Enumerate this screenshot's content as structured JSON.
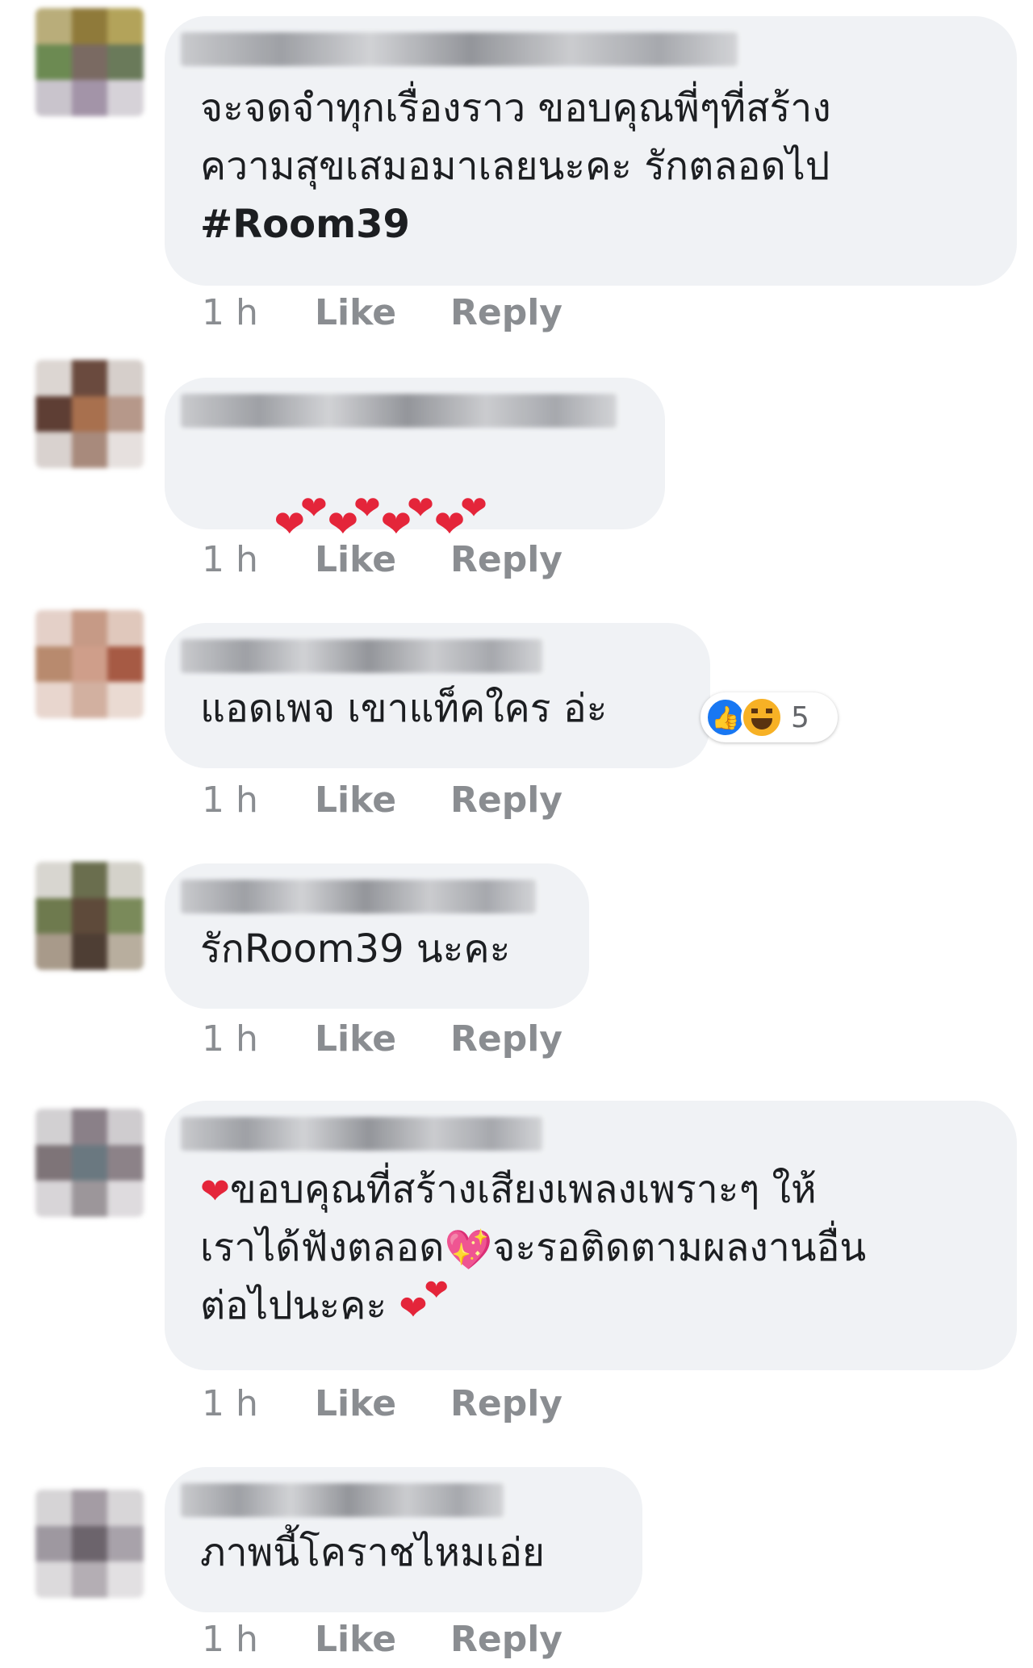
{
  "comments": [
    {
      "text": "จะจดจำทุกเรื่องราว ขอบคุณพี่ๆที่สร้าง\nความสุขเสมอมาเลยนะคะ รักตลอดไป",
      "hashtag": "#Room39",
      "time": "1 h",
      "like": "Like",
      "reply": "Reply"
    },
    {
      "text": "",
      "hearts": "❤❤❤❤",
      "time": "1 h",
      "like": "Like",
      "reply": "Reply"
    },
    {
      "text": "แอดเพจ เขาแท็คใคร อ่ะ",
      "reaction_count": "5",
      "reaction_icons": [
        "like-icon",
        "haha-icon"
      ],
      "time": "1 h",
      "like": "Like",
      "reply": "Reply"
    },
    {
      "text": "รักRoom39 นะคะ",
      "time": "1 h",
      "like": "Like",
      "reply": "Reply"
    },
    {
      "text_line1": "ขอบคุณที่สร้างเสียงเพลงเพราะๆ ให้",
      "text_line2a": "เราได้ฟังตลอด",
      "text_line2b": "จะรอติดตามผลงานอื่น",
      "text_line3": "ต่อไปนะคะ ",
      "time": "1 h",
      "like": "Like",
      "reply": "Reply"
    },
    {
      "text": "ภาพนี้โคราชไหมเอ่ย",
      "time": "1 h",
      "like": "Like",
      "reply": "Reply"
    }
  ],
  "colors": {
    "bubble": "#f0f2f5",
    "action_text": "#8a8d91",
    "heart": "#e4253a",
    "like_blue": "#1877f2"
  }
}
